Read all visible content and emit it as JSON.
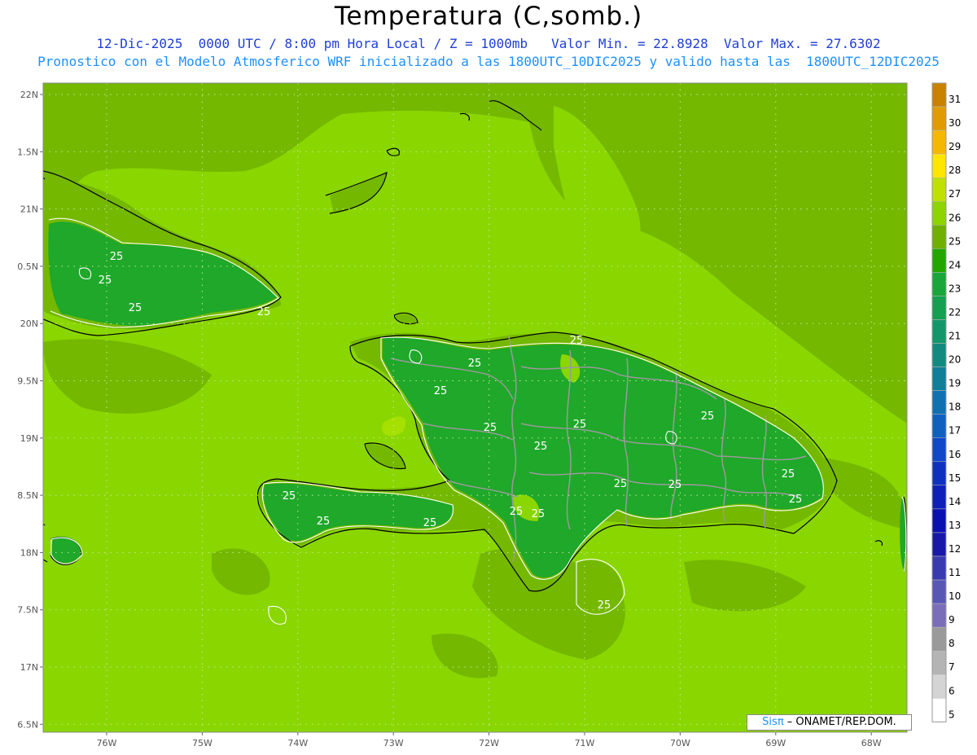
{
  "header": {
    "title": "Temperatura (C,somb.)",
    "line1": "12-Dic-2025  0000 UTC / 8:00 pm Hora Local / Z = 1000mb   Valor Min. = 22.8928  Valor Max. = 27.6302",
    "line2": "Pronostico con el Modelo Atmosferico WRF inicializado a las 1800UTC_10DIC2025 y valido hasta las  1800UTC_12DIC2025"
  },
  "axes": {
    "lat_ticks": [
      "22N",
      "1.5N",
      "21N",
      "0.5N",
      "20N",
      "9.5N",
      "19N",
      "8.5N",
      "18N",
      "7.5N",
      "17N",
      "6.5N"
    ],
    "lon_ticks": [
      "76W",
      "75W",
      "74W",
      "73W",
      "72W",
      "71W",
      "70W",
      "69W",
      "68W"
    ],
    "lat_range": [
      16.5,
      22.0
    ],
    "lon_range": [
      -76.7,
      -67.6
    ]
  },
  "colorbar": {
    "labels": [
      "31",
      "30",
      "29",
      "28",
      "27",
      "26",
      "25",
      "24",
      "23",
      "22",
      "21",
      "20",
      "19",
      "18",
      "17",
      "16",
      "15",
      "14",
      "13",
      "12",
      "11",
      "10",
      "9",
      "8",
      "7",
      "6",
      "5"
    ],
    "colors": [
      "#c88200",
      "#e09b00",
      "#f5b800",
      "#ffe600",
      "#bfe000",
      "#8ed400",
      "#6fb000",
      "#24a600",
      "#1aa63a",
      "#14a050",
      "#14966b",
      "#138a80",
      "#127e98",
      "#1170b0",
      "#1160c0",
      "#1148c8",
      "#1030c0",
      "#0e20b8",
      "#0a10b0",
      "#1818a8",
      "#3a3ab0",
      "#5858b4",
      "#7a6eb8",
      "#9a9a9a",
      "#b4b4b4",
      "#d4d4d4",
      "#ffffff"
    ]
  },
  "contour_labels": [
    "25",
    "25",
    "25",
    "25",
    "25",
    "25",
    "25",
    "25",
    "25",
    "25",
    "25",
    "25",
    "25",
    "25",
    "25",
    "25",
    "25",
    "25",
    "25",
    "25",
    "25"
  ],
  "colors": {
    "sea_light": "#8ad600",
    "sea_dark": "#74b800",
    "land_warm": "#18a818",
    "land_mid": "#74b800",
    "title_blue": "#1f3fd6",
    "subtitle_blue": "#1e90ff"
  },
  "credit": {
    "brand": "Sis",
    "pi": "π",
    "text": "– ONAMET/REP.DOM."
  }
}
